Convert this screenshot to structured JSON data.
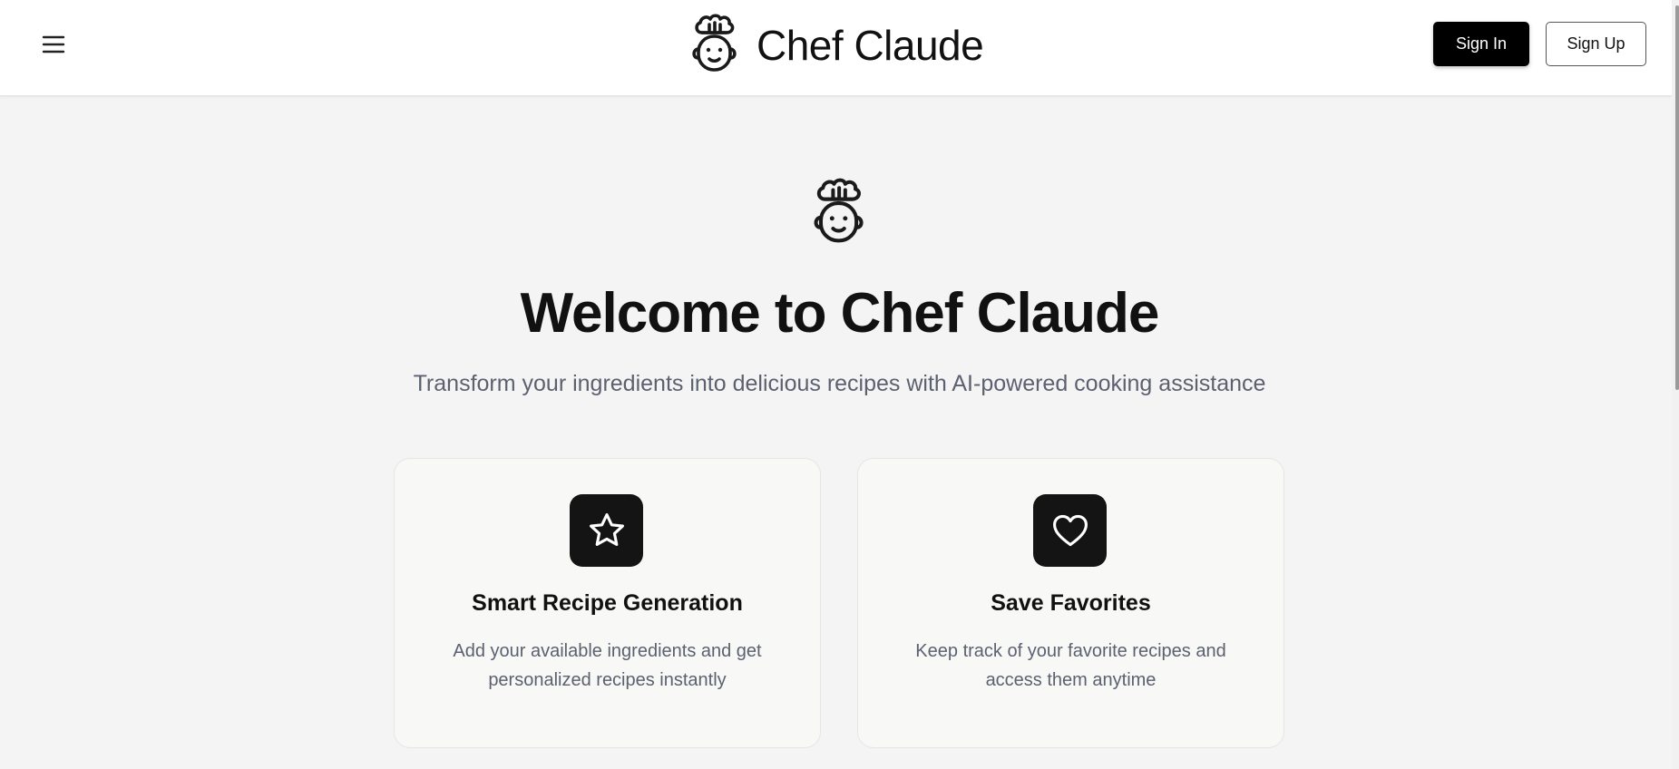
{
  "header": {
    "menu_icon": "hamburger-menu-icon",
    "logo_icon": "chef-robot-icon",
    "brand_title": "Chef Claude",
    "sign_in_label": "Sign In",
    "sign_up_label": "Sign Up"
  },
  "hero": {
    "logo_icon": "chef-robot-icon",
    "title": "Welcome to Chef Claude",
    "subtitle": "Transform your ingredients into delicious recipes with AI-powered cooking assistance"
  },
  "features": [
    {
      "icon": "star-icon",
      "title": "Smart Recipe Generation",
      "description": "Add your available ingredients and get personalized recipes instantly"
    },
    {
      "icon": "heart-icon",
      "title": "Save Favorites",
      "description": "Keep track of your favorite recipes and access them anytime"
    }
  ],
  "colors": {
    "page_background": "#f4f4f4",
    "header_background": "#ffffff",
    "primary_button": "#000000",
    "icon_tile": "#141414",
    "muted_text": "#5c6170"
  }
}
